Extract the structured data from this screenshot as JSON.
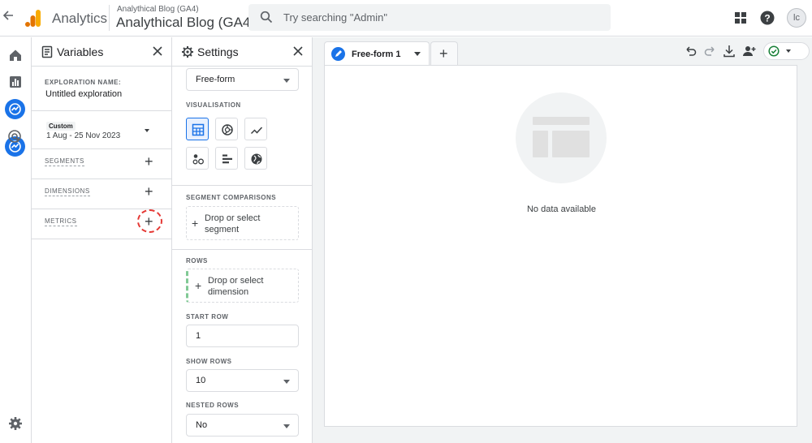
{
  "topbar": {
    "app_name": "Analytics",
    "account_small": "Analythical Blog (GA4)",
    "account_big": "Analythical Blog (GA4)",
    "search_placeholder": "Try searching \"Admin\"",
    "avatar_initial": "lc"
  },
  "variables": {
    "title": "Variables",
    "exploration_label": "EXPLORATION NAME:",
    "exploration_name": "Untitled exploration",
    "date_type": "Custom",
    "date_range": "1 Aug - 25 Nov 2023",
    "segments": "SEGMENTS",
    "dimensions": "DIMENSIONS",
    "metrics": "METRICS"
  },
  "settings": {
    "title": "Settings",
    "technique_value": "Free-form",
    "visualisation_label": "VISUALISATION",
    "segment_comparisons_label": "SEGMENT COMPARISONS",
    "segment_drop": "Drop or select segment",
    "rows_label": "ROWS",
    "rows_drop": "Drop or select dimension",
    "start_row_label": "START ROW",
    "start_row_value": "1",
    "show_rows_label": "SHOW ROWS",
    "show_rows_value": "10",
    "nested_rows_label": "NESTED ROWS",
    "nested_rows_value": "No"
  },
  "canvas": {
    "tab_label": "Free-form 1",
    "empty_text": "No data available"
  },
  "colors": {
    "accent": "#1a73e8",
    "logo_orange": "#f9ab00",
    "logo_dark": "#e37400",
    "highlight_red": "#e53935",
    "rows_green": "#81c995"
  }
}
